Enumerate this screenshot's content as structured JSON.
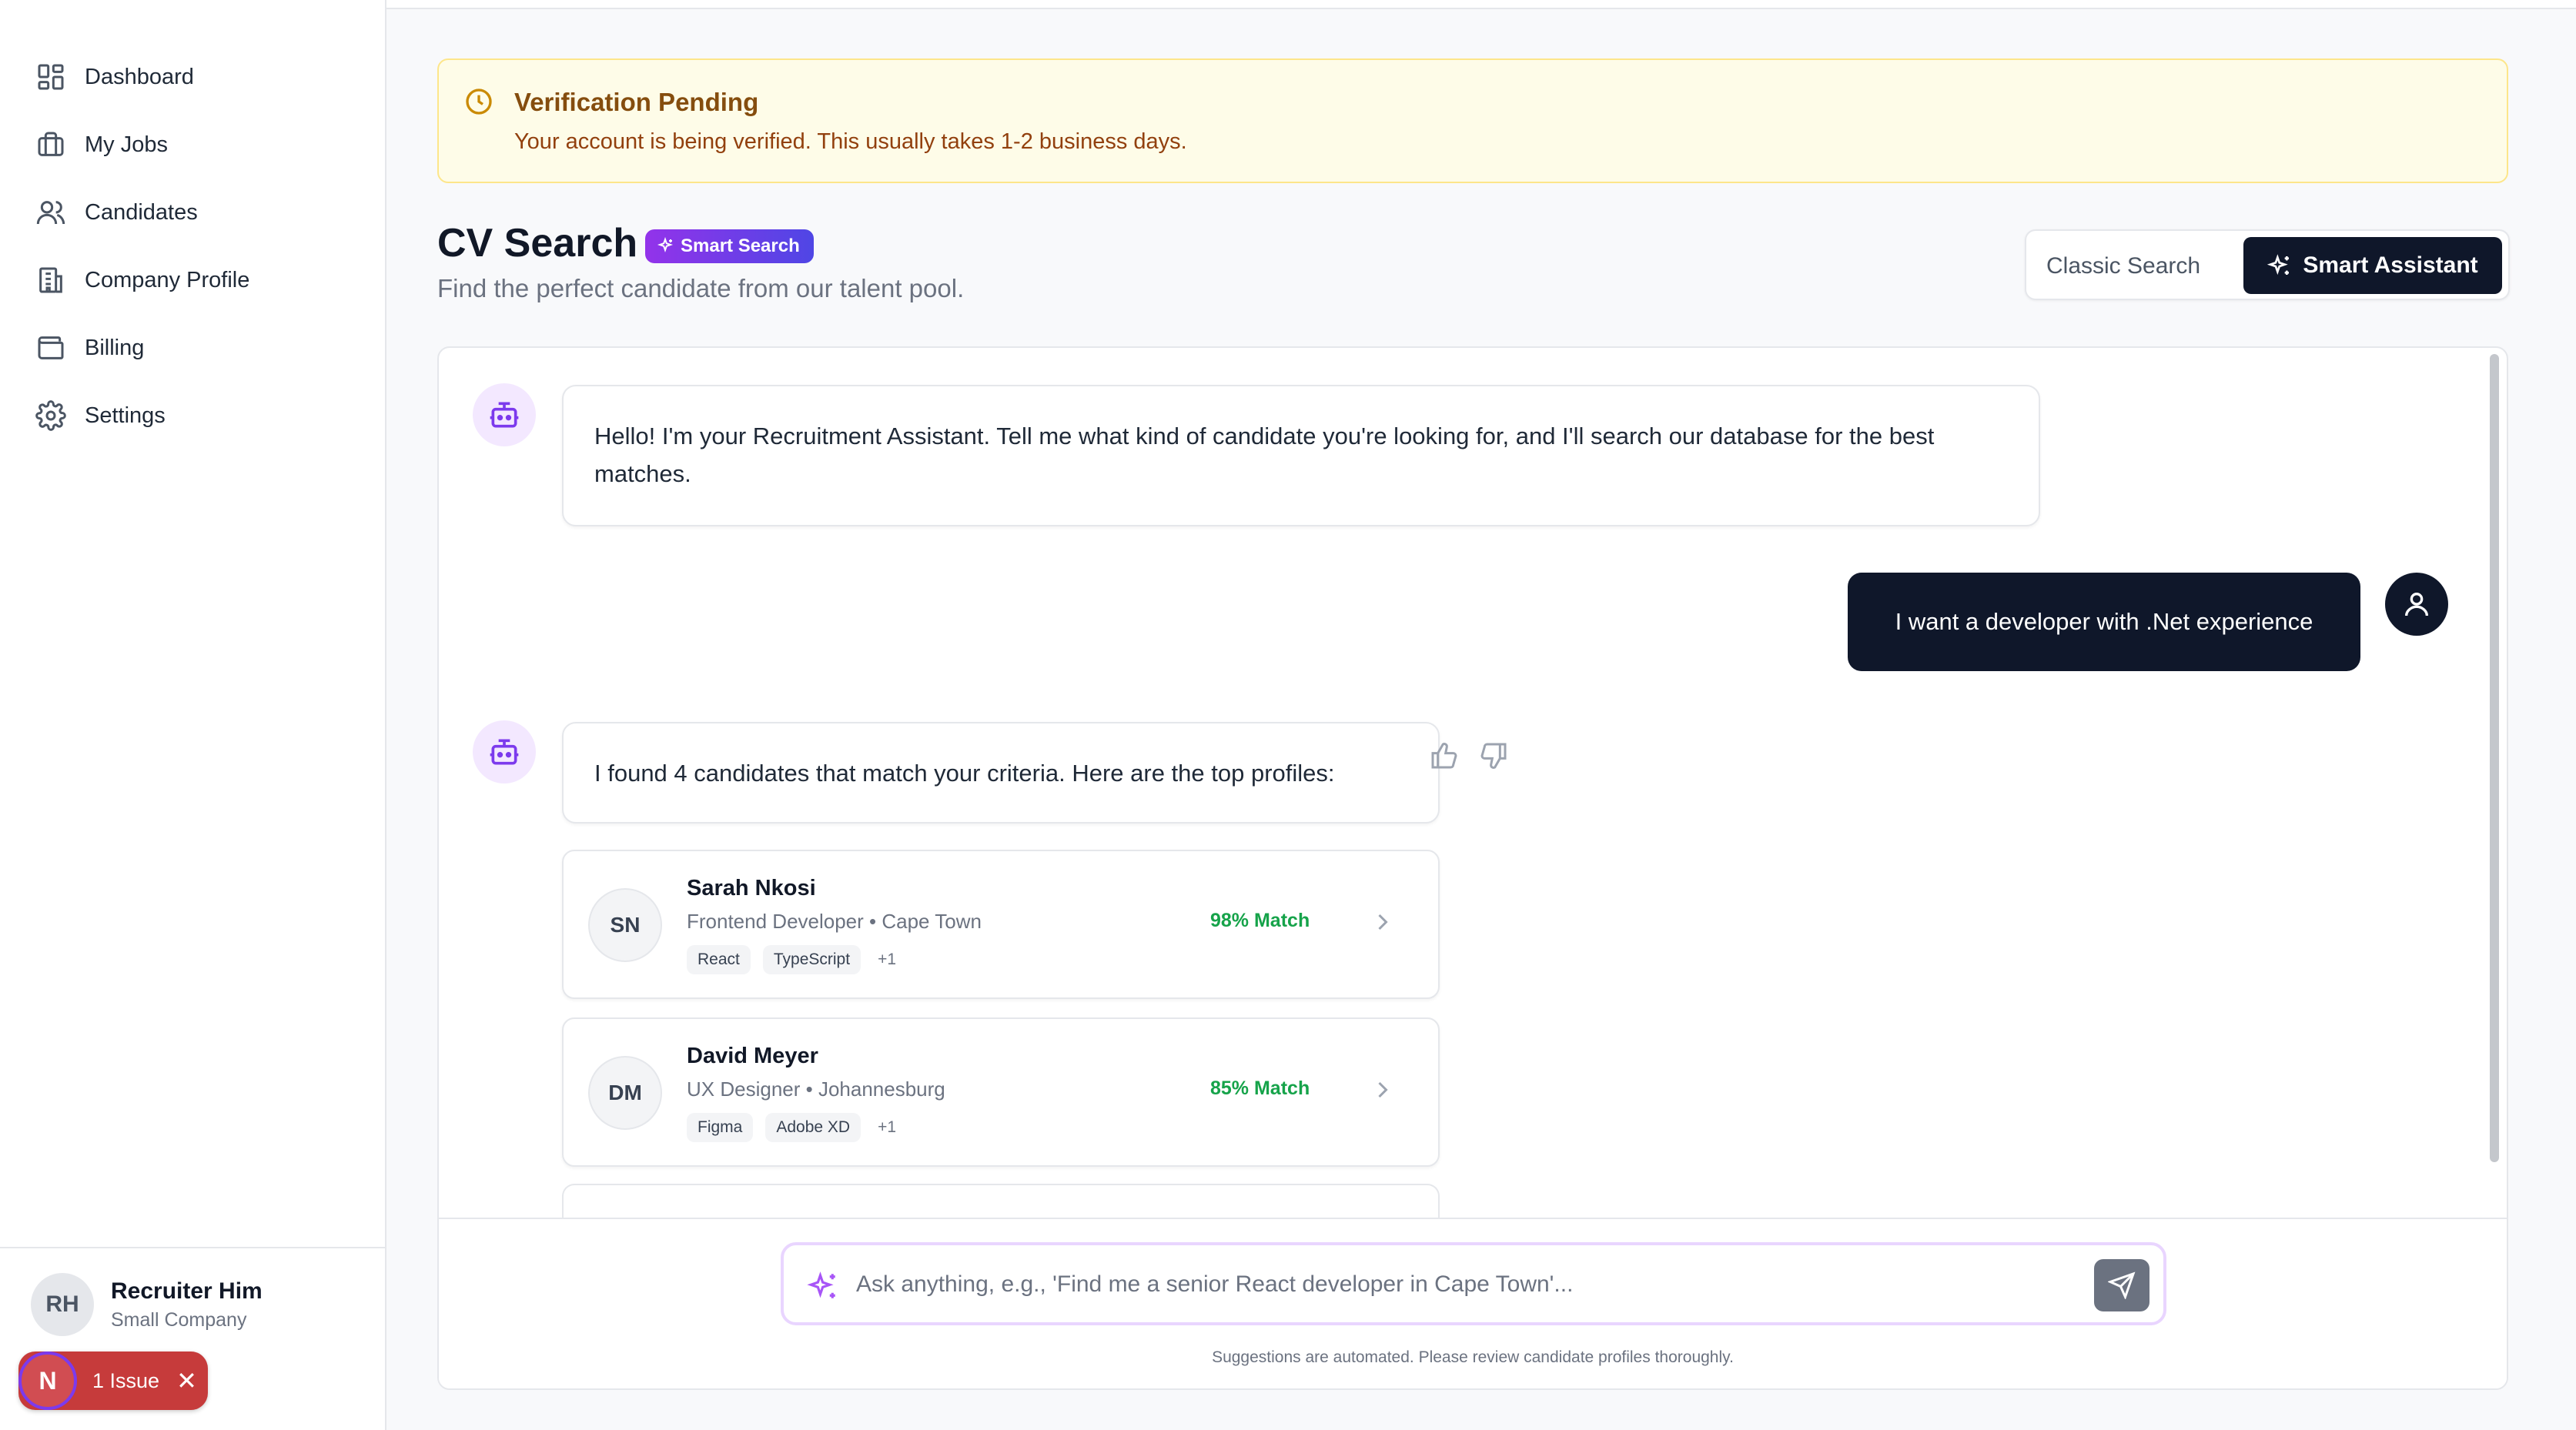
{
  "sidebar": {
    "items": [
      {
        "label": "Dashboard",
        "icon": "dashboard-icon"
      },
      {
        "label": "My Jobs",
        "icon": "briefcase-icon"
      },
      {
        "label": "Candidates",
        "icon": "users-icon"
      },
      {
        "label": "Company Profile",
        "icon": "building-icon"
      },
      {
        "label": "Billing",
        "icon": "wallet-icon"
      },
      {
        "label": "Settings",
        "icon": "gear-icon"
      }
    ],
    "user": {
      "initials": "RH",
      "name": "Recruiter Him",
      "company": "Small Company"
    },
    "issue": {
      "initial": "N",
      "label": "1 Issue",
      "close": "✕"
    }
  },
  "banner": {
    "title": "Verification Pending",
    "text": "Your account is being verified. This usually takes 1-2 business days."
  },
  "header": {
    "title": "CV Search",
    "badge": "Smart Search",
    "subtitle": "Find the perfect candidate from our talent pool.",
    "modes": {
      "classic": "Classic Search",
      "smart": "Smart Assistant",
      "active": "smart"
    }
  },
  "chat": {
    "messages": [
      {
        "role": "assistant",
        "text": "Hello! I'm your Recruitment Assistant. Tell me what kind of candidate you're looking for, and I'll search our database for the best matches."
      },
      {
        "role": "user",
        "text": "I want a developer with .Net experience"
      },
      {
        "role": "assistant",
        "text": "I found 4 candidates that match your criteria. Here are the top profiles:"
      }
    ],
    "candidates": [
      {
        "initials": "SN",
        "name": "Sarah Nkosi",
        "meta": "Frontend Developer • Cape Town",
        "tags": [
          "React",
          "TypeScript"
        ],
        "more": "+1",
        "match": "98% Match"
      },
      {
        "initials": "DM",
        "name": "David Meyer",
        "meta": "UX Designer • Johannesburg",
        "tags": [
          "Figma",
          "Adobe XD"
        ],
        "more": "+1",
        "match": "85% Match"
      }
    ],
    "input": {
      "placeholder": "Ask anything, e.g., 'Find me a senior React developer in Cape Town'...",
      "value": ""
    },
    "disclaimer": "Suggestions are automated. Please review candidate profiles thoroughly."
  },
  "colors": {
    "accent": "#7c3aed",
    "dark": "#0f172a",
    "warning_bg": "#fefce8",
    "match": "#16a34a",
    "issue": "#c63b3b"
  }
}
